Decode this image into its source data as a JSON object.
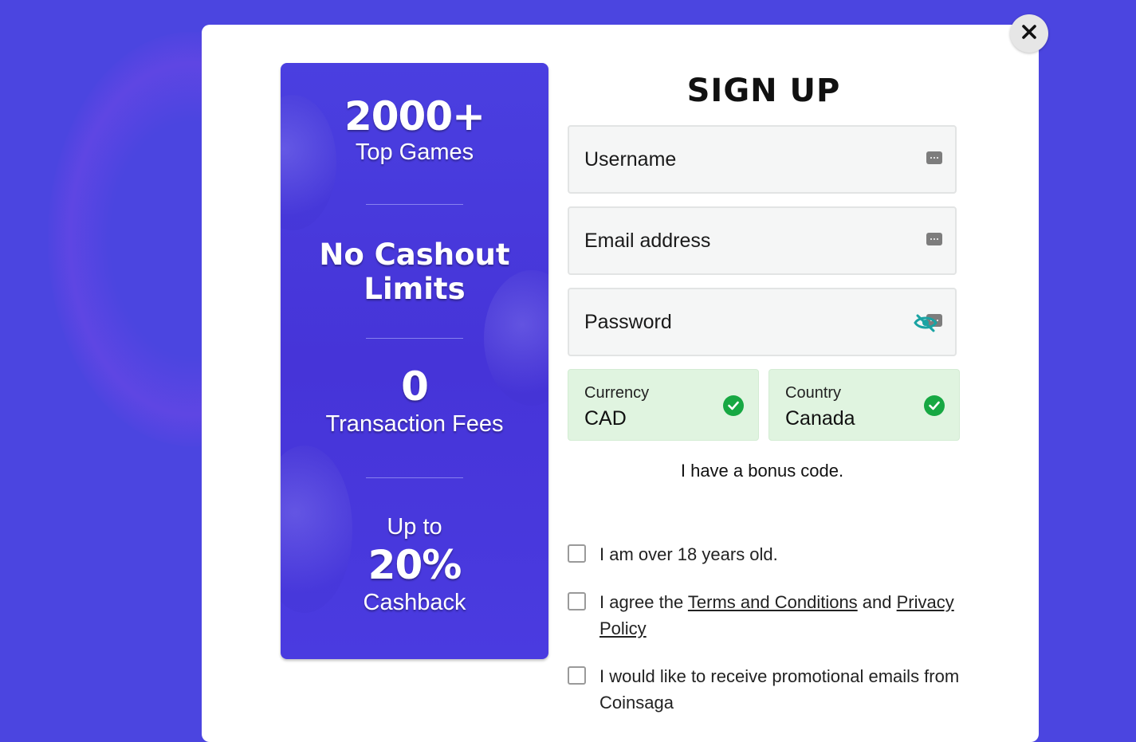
{
  "modal": {
    "title": "SIGN UP",
    "close_icon": "close-icon"
  },
  "promo": {
    "games_count": "2000+",
    "games_label": "Top Games",
    "cashout_line1": "No Cashout",
    "cashout_line2": "Limits",
    "fees_count": "0",
    "fees_label": "Transaction Fees",
    "cashback_prefix": "Up to",
    "cashback_value": "20%",
    "cashback_label": "Cashback"
  },
  "form": {
    "username_placeholder": "Username",
    "email_placeholder": "Email address",
    "password_placeholder": "Password",
    "currency_label": "Currency",
    "currency_value": "CAD",
    "country_label": "Country",
    "country_value": "Canada",
    "bonus_link": "I have a bonus code.",
    "age_text": "I am over 18 years old.",
    "agree_prefix": "I agree the ",
    "terms_link": "Terms and Conditions",
    "agree_and": " and ",
    "privacy_link": "Privacy Policy",
    "promo_emails_text": "I would like to receive promotional emails from Coinsaga"
  },
  "colors": {
    "background": "#4b45e0",
    "promo_panel": "#4634d8",
    "select_ok_bg": "#e0f4e0",
    "check_green": "#17a843",
    "eye_teal": "#1aa3a3"
  }
}
